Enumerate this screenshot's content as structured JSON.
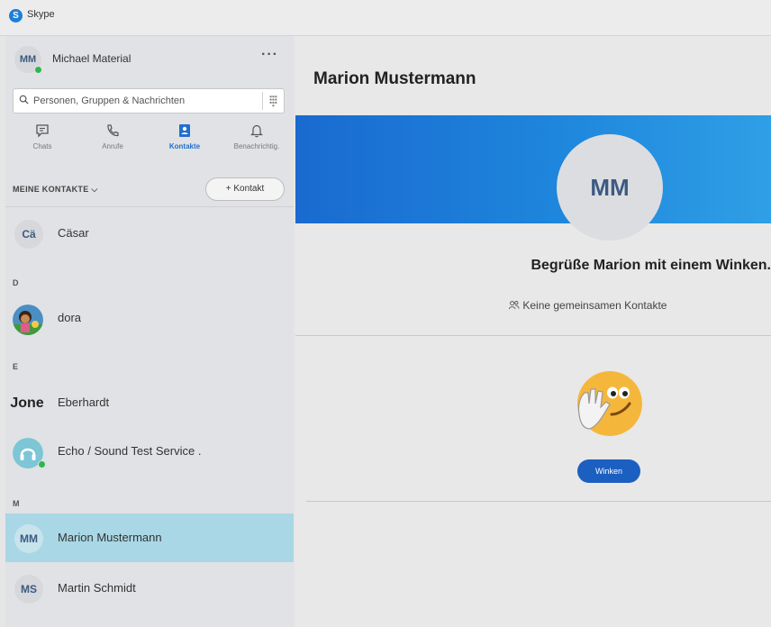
{
  "window": {
    "title": "Skype"
  },
  "profile": {
    "initials": "MM",
    "name": "Michael Material",
    "more_label": "···"
  },
  "search": {
    "placeholder": "Personen, Gruppen & Nachrichten"
  },
  "nav_tabs": [
    {
      "label": "Chats",
      "icon": "chat-icon"
    },
    {
      "label": "Anrufe",
      "icon": "phone-icon"
    },
    {
      "label": "Kontakte",
      "icon": "contacts-icon",
      "active": true
    },
    {
      "label": "Benachrichtig.",
      "icon": "bell-icon"
    }
  ],
  "contacts_header": {
    "label": "MEINE KONTAKTE ⌵",
    "add_button": "+ Kontakt"
  },
  "contact_list": {
    "sections": {
      "d": "D",
      "e": "E",
      "m": "M"
    },
    "items": [
      {
        "initials": "Cä",
        "name": "Cäsar"
      },
      {
        "initials": "",
        "name": "dora"
      },
      {
        "initials": "Jone",
        "name": "Eberhardt"
      },
      {
        "initials": "",
        "name": "Echo / Sound Test Service ."
      },
      {
        "initials": "MM",
        "name": "Marion Mustermann",
        "selected": true
      },
      {
        "initials": "MS",
        "name": "Martin Schmidt"
      }
    ]
  },
  "main": {
    "title": "Marion Mustermann",
    "avatar_initials": "MM",
    "greeting": "Begrüße Marion mit einem Winken.",
    "mutual_contacts": "Keine gemeinsamen Kontakte",
    "wave_button": "Winken"
  },
  "colors": {
    "accent": "#1f6fd0",
    "selected_row": "#a9d7e6",
    "banner": "#1e86dc",
    "presence": "#2db84d"
  }
}
